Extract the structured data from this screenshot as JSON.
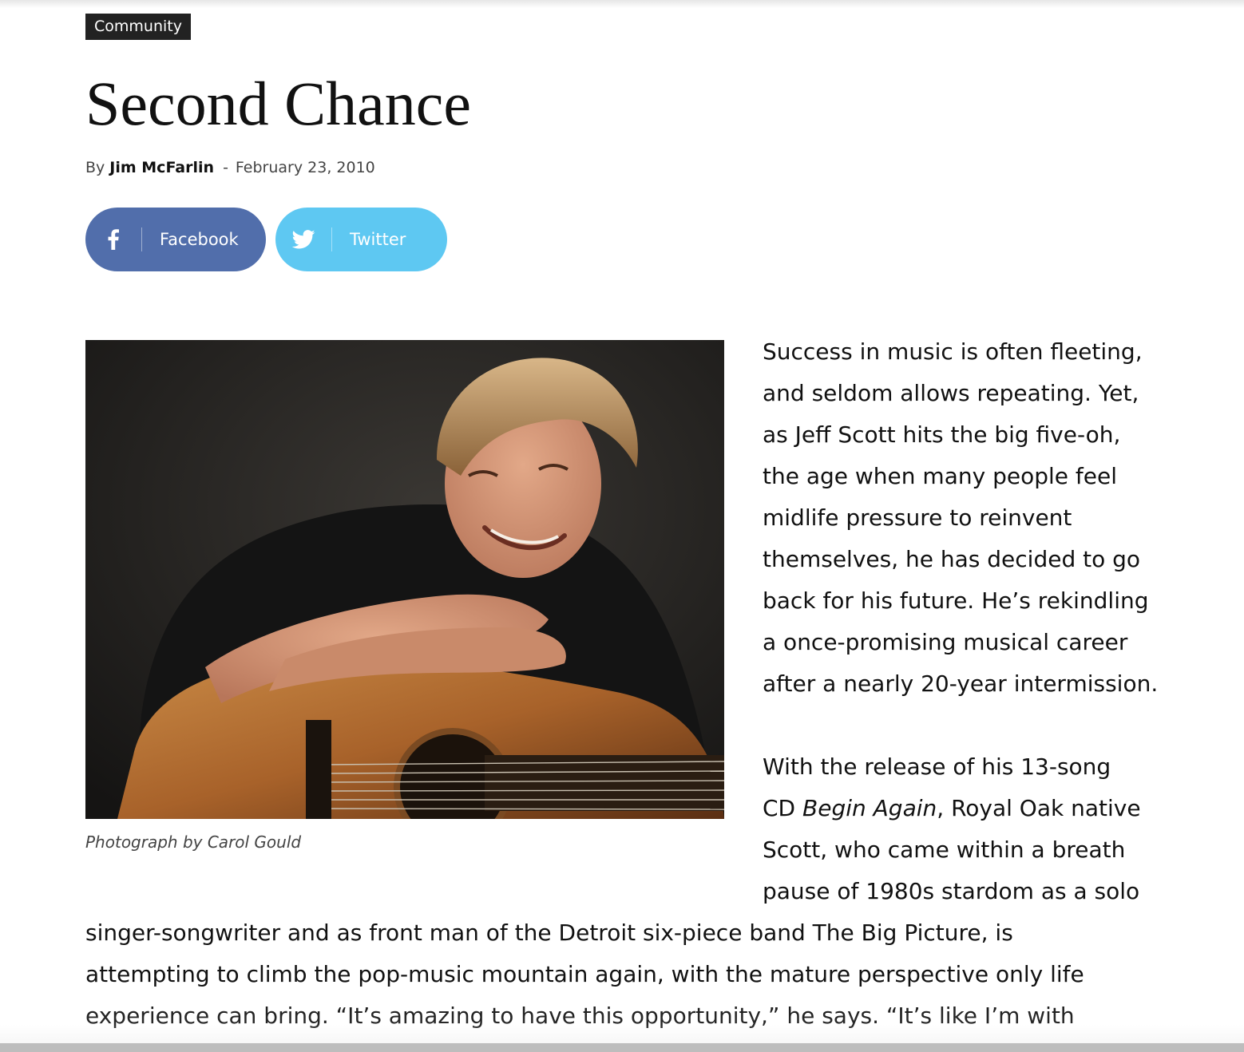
{
  "category": "Community",
  "article": {
    "title": "Second Chance",
    "byline": {
      "by": "By",
      "author": "Jim McFarlin",
      "separator": "-",
      "date": "February 23, 2010"
    }
  },
  "share": {
    "facebook": {
      "label": "Facebook",
      "icon": "facebook-icon",
      "color": "#516eab"
    },
    "twitter": {
      "label": "Twitter",
      "icon": "twitter-icon",
      "color": "#5ec8f2"
    }
  },
  "photo": {
    "caption": "Photograph by Carol Gould"
  },
  "body": {
    "para1_lines": [
      "Success in music is often fleeting,",
      "and seldom allows repeating. Yet,",
      "as Jeff Scott hits the big five-oh,",
      "the age when many people feel",
      "midlife pressure to reinvent",
      "themselves, he has decided to go",
      "back for his future. He’s rekindling",
      "a once-promising musical career",
      "after a nearly 20-year intermission."
    ],
    "para2_line1": "With the release of his 13-song",
    "para2_line2_pre": "CD ",
    "para2_line2_italic": "Begin Again",
    "para2_line2_post": ", Royal Oak native",
    "para2_lines_rest": [
      "Scott, who came within a breath",
      "pause of 1980s stardom as a solo"
    ],
    "para2_full_lines": [
      "singer-songwriter and as front man of the Detroit six-piece band The Big Picture, is",
      "attempting to climb the pop-music mountain again, with the mature perspective only life",
      "experience can bring. “It’s amazing to have this opportunity,” he says. “It’s like I’m with"
    ]
  }
}
